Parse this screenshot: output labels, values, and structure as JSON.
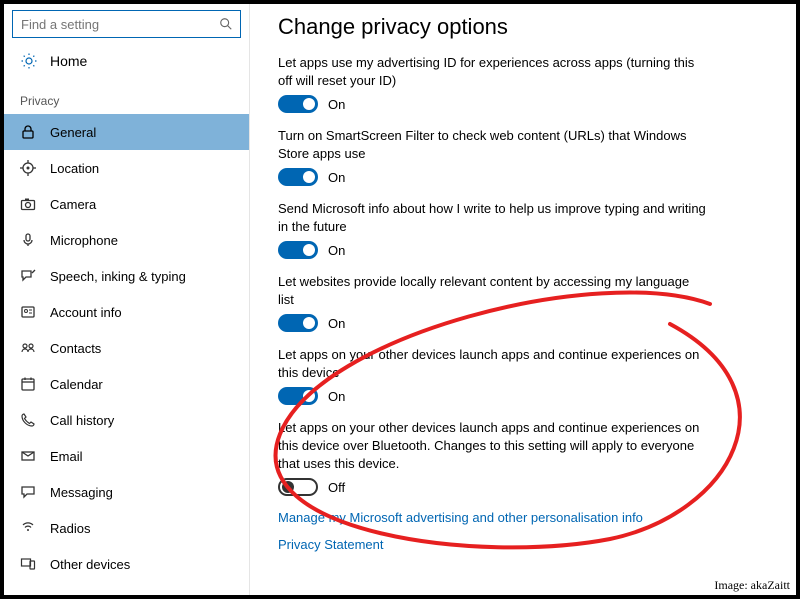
{
  "search": {
    "placeholder": "Find a setting"
  },
  "home_label": "Home",
  "section_label": "Privacy",
  "nav": {
    "general": "General",
    "location": "Location",
    "camera": "Camera",
    "microphone": "Microphone",
    "speech": "Speech, inking & typing",
    "account": "Account info",
    "contacts": "Contacts",
    "calendar": "Calendar",
    "callhistory": "Call history",
    "email": "Email",
    "messaging": "Messaging",
    "radios": "Radios",
    "otherdevices": "Other devices"
  },
  "page_title": "Change privacy options",
  "settings": {
    "adid": {
      "desc": "Let apps use my advertising ID for experiences across apps (turning this off will reset your ID)",
      "state": "On"
    },
    "smartscreen": {
      "desc": "Turn on SmartScreen Filter to check web content (URLs) that Windows Store apps use",
      "state": "On"
    },
    "typing": {
      "desc": "Send Microsoft info about how I write to help us improve typing and writing in the future",
      "state": "On"
    },
    "lang": {
      "desc": "Let websites provide locally relevant content by accessing my language list",
      "state": "On"
    },
    "crossdev": {
      "desc": "Let apps on your other devices launch apps and continue experiences on this device",
      "state": "On"
    },
    "crossdevbt": {
      "desc": "Let apps on your other devices launch apps and continue experiences on this device over Bluetooth. Changes to this setting will apply to everyone that uses this device.",
      "state": "Off"
    }
  },
  "links": {
    "manage_ads": "Manage my Microsoft advertising and other personalisation info",
    "privacy_stmt": "Privacy Statement"
  },
  "credit": "Image: akaZaitt"
}
